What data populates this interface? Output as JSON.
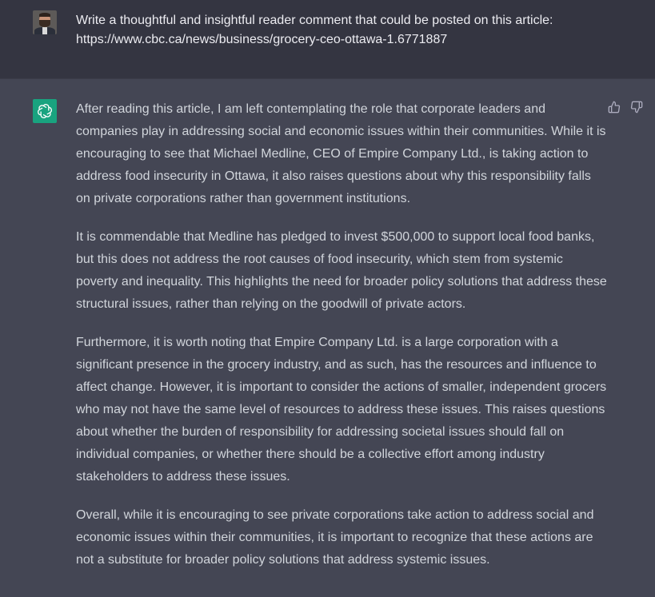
{
  "user_message": {
    "text": "Write a thoughtful and insightful reader comment that could be posted on this article: https://www.cbc.ca/news/business/grocery-ceo-ottawa-1.6771887"
  },
  "assistant_message": {
    "paragraphs": [
      "After reading this article, I am left contemplating the role that corporate leaders and companies play in addressing social and economic issues within their communities. While it is encouraging to see that Michael Medline, CEO of Empire Company Ltd., is taking action to address food insecurity in Ottawa, it also raises questions about why this responsibility falls on private corporations rather than government institutions.",
      "It is commendable that Medline has pledged to invest $500,000 to support local food banks, but this does not address the root causes of food insecurity, which stem from systemic poverty and inequality. This highlights the need for broader policy solutions that address these structural issues, rather than relying on the goodwill of private actors.",
      "Furthermore, it is worth noting that Empire Company Ltd. is a large corporation with a significant presence in the grocery industry, and as such, has the resources and influence to affect change. However, it is important to consider the actions of smaller, independent grocers who may not have the same level of resources to address these issues. This raises questions about whether the burden of responsibility for addressing societal issues should fall on individual companies, or whether there should be a collective effort among industry stakeholders to address these issues.",
      "Overall, while it is encouraging to see private corporations take action to address social and economic issues within their communities, it is important to recognize that these actions are not a substitute for broader policy solutions that address systemic issues."
    ]
  },
  "icons": {
    "user_avatar": "user-avatar",
    "assistant_avatar": "openai-logo-icon",
    "thumbs_up": "thumbs-up-icon",
    "thumbs_down": "thumbs-down-icon"
  },
  "colors": {
    "user_bg": "#343541",
    "assistant_bg": "#444654",
    "assistant_icon_bg": "#19a37f",
    "user_text": "#ececf1",
    "assistant_text": "#d1d5db"
  }
}
